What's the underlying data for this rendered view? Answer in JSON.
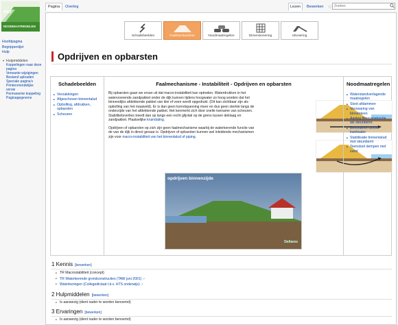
{
  "logo": {
    "top_text": "WIKI",
    "bottom_text": "NOODMAATREGELEN"
  },
  "nav": {
    "items": [
      "Hoofdpagina",
      "Begrippenlijst",
      "Hulp"
    ],
    "section_title": "Hulpmiddelen",
    "tools": [
      "Koppelingen naar deze pagina",
      "Verwante wijzigingen",
      "Bestand uploaden",
      "Speciale pagina's",
      "Printervriendelijke versie",
      "Permanente koppeling",
      "Paginagegevens"
    ]
  },
  "tabs": {
    "page": "Pagina",
    "talk": "Overleg",
    "read": "Lezen",
    "edit": "Bewerken"
  },
  "search": {
    "placeholder": "Zoeken"
  },
  "tiles": [
    "Schadebeelden",
    "Faalmechanisme",
    "Noodmaatregelen",
    "Dimensionering",
    "Uitvoering"
  ],
  "page_title": "Opdrijven en opbarsten",
  "box": {
    "left_title": "Schadebeelden",
    "left_links": [
      "Verzakkingen",
      "Afgeschoven binnentalud",
      "Opbolling, afdrukken, opbarsten",
      "Scheuren"
    ],
    "middle_title": "Faalmechanisme - Instabiliteit - Opdrijven en opbarsten",
    "para1": "Bij opbarsten gaan we ervan uit dat macro-instabiliteit kan optreden. Waterdrukken in het watervoerende zandpakket onder de dijk kunnen tijdens hoogwater zo hoog worden dat het binnendijks afdekkende pakket van klei of veen wordt opgedrukt. (Dit kan zichtbaar zijn als opbolling van het maaiveld). Er is dan geen korrelspanning meer en dus geen sterkte langs de onderzijde van het afdekkende pakket. Het kenmerkt zich door snelle toename van scheuren. Stabiliteitsverlies treedt dan op langs een recht glijvlak op de grens tussen deklaag en zandpakket. Plaatselijke",
    "para1_link": "kruindaling",
    "para2": "Opdrijven of opbarsten op zich zijn geen faalmechanisme waarbij de waterkerende functie van de van de dijk in direct gevaar is. Opdrijven of opbarsten kunnen wel inleidende mechanismen zijn voor",
    "para2_link": "macro-instabiliteit van het binnentalud of piping",
    "photo_label": "opdrijven binnenzijde",
    "photo_brand": "Deltares",
    "right_title": "Noodmaatregelen",
    "right_links": [
      "Waterstandverlagende maatregelen",
      "Sloot afdammen",
      "Verzwaring van binnenteen",
      "Aanleg filterconstructie als steunberm",
      "Bevorderen afvoer kwelwater",
      "Stabilisatie binnentalud met steunberm",
      "Teenstoel dempen met zand"
    ]
  },
  "sections": {
    "kennis": {
      "title": "1 Kennis",
      "edit": "[bewerken]",
      "items": [
        "TR Macrostabiliteit (concept)",
        "TR Waterkerende grondconstructies (TAW juni 2001)",
        "Waterkeringen (Collegedictaat t.b.v. HTS onderwijs)"
      ]
    },
    "hulpmiddelen": {
      "title": "2 Hulpmiddelen",
      "edit": "[bewerken]",
      "items": [
        "Is aanwezig (dient nader te worden benoemd)"
      ]
    },
    "ervaringen": {
      "title": "3 Ervaringen",
      "edit": "[bewerken]",
      "items": [
        "Is aanwezig (dient nader te worden benoemd)"
      ]
    }
  },
  "colors": {
    "accent": "#c62828",
    "tile_active": "#f2a35f",
    "link": "#0645ad"
  }
}
